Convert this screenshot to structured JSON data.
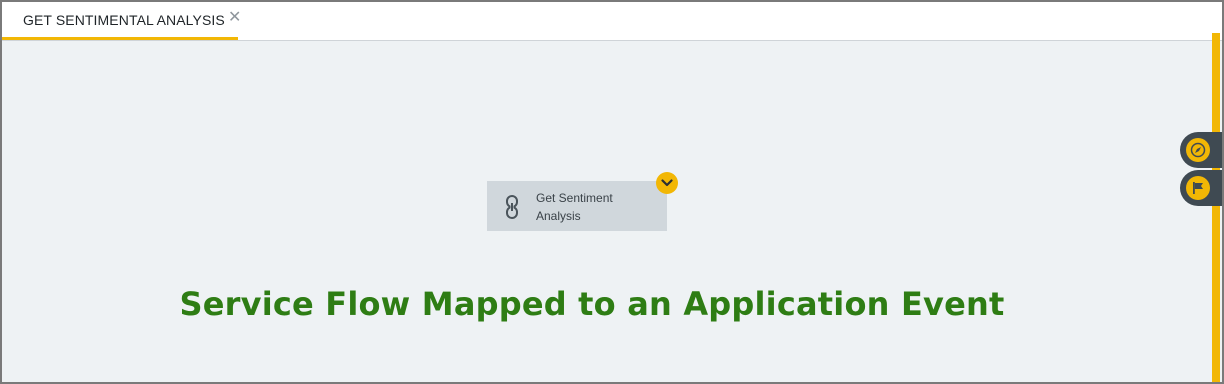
{
  "tabs": [
    {
      "label": "GET SENTIMENTAL ANALYSIS",
      "close_icon": "close-icon",
      "active": true
    }
  ],
  "canvas": {
    "node": {
      "label": "Get Sentiment Analysis",
      "icon": "link-icon",
      "toggle_icon": "chevron-down-icon"
    },
    "caption": "Service Flow Mapped to an Application Event"
  },
  "side_tools": [
    {
      "icon": "compass-icon"
    },
    {
      "icon": "flag-icon"
    }
  ],
  "colors": {
    "accent": "#f2b705",
    "caption": "#2e7d14",
    "node_bg": "#d0d7dc",
    "canvas_bg": "#eef2f4",
    "tool_bg": "#3f4a52"
  }
}
